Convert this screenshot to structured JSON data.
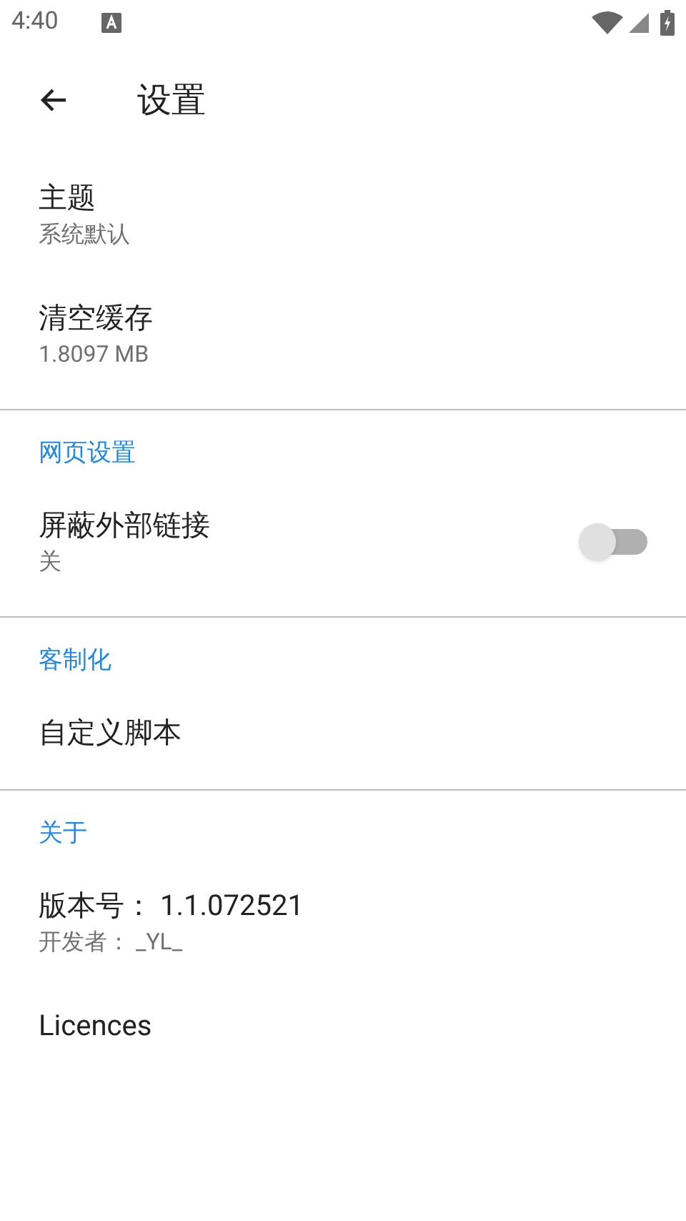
{
  "status_bar": {
    "time": "4:40"
  },
  "app_bar": {
    "title": "设置"
  },
  "sections": [
    {
      "items": [
        {
          "kind": "text",
          "title": "主题",
          "summary": "系统默认"
        },
        {
          "kind": "text",
          "title": "清空缓存",
          "summary": "1.8097 MB"
        }
      ]
    },
    {
      "header": "网页设置",
      "items": [
        {
          "kind": "switch",
          "title": "屏蔽外部链接",
          "summary": "关",
          "on": false
        }
      ]
    },
    {
      "header": "客制化",
      "items": [
        {
          "kind": "text",
          "title": "自定义脚本"
        }
      ]
    },
    {
      "header": "关于",
      "items": [
        {
          "kind": "text",
          "title": "版本号：  1.1.072521",
          "summary": "开发者：  _YL_"
        },
        {
          "kind": "text",
          "title": "Licences"
        }
      ]
    }
  ]
}
